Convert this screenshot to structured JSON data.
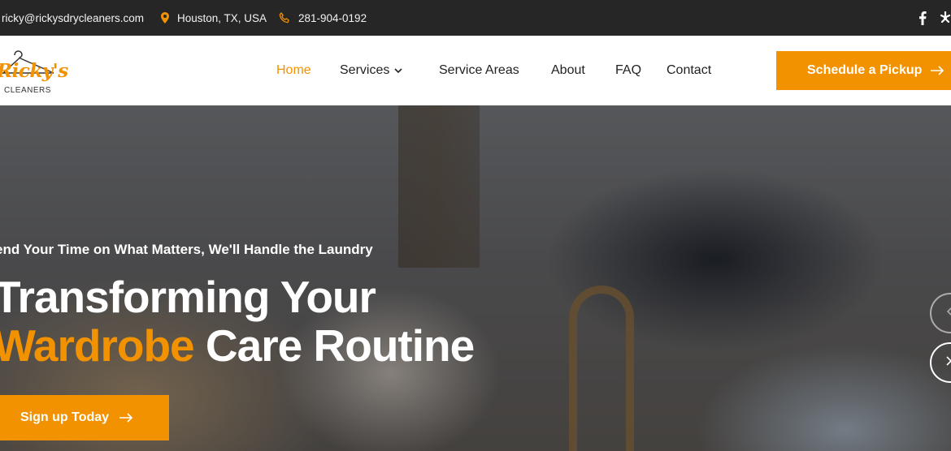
{
  "topbar": {
    "email": "ricky@rickysdrycleaners.com",
    "location": "Houston, TX, USA",
    "phone": "281-904-0192",
    "icons": [
      "mail-icon",
      "location-pin-icon",
      "phone-icon",
      "facebook-icon",
      "yelp-icon"
    ]
  },
  "logo": {
    "script_text": "Ricky's",
    "sub_text": "CLEANERS"
  },
  "nav": {
    "home": "Home",
    "services": "Services",
    "service_areas": "Service Areas",
    "about": "About",
    "faq": "FAQ",
    "contact": "Contact",
    "active": "Home"
  },
  "header_cta": {
    "label": "Schedule a Pickup"
  },
  "hero": {
    "subtitle": "end Your Time on What Matters, We'll Handle the Laundry",
    "title_line1": "Transforming Your",
    "title_accent": "Wardrobe",
    "title_line2_rest": " Care Routine",
    "cta_label": "Sign up Today"
  },
  "colors": {
    "accent": "#f39200",
    "topbar_bg": "#262626",
    "text_dark": "#222222"
  }
}
